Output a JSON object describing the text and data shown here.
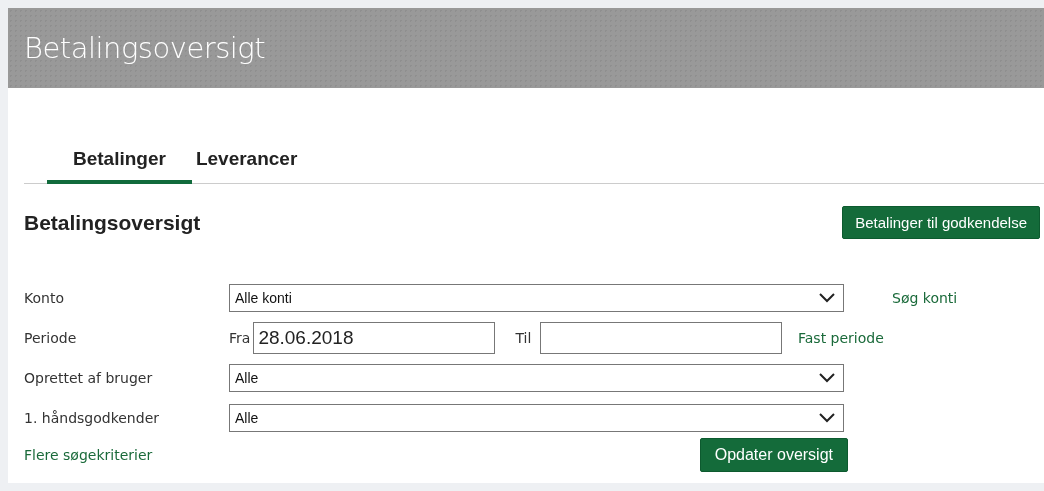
{
  "header": {
    "title": "Betalingsoversigt"
  },
  "tabs": [
    {
      "label": "Betalinger",
      "selected": true
    },
    {
      "label": "Leverancer",
      "selected": false
    }
  ],
  "section": {
    "title": "Betalingsoversigt",
    "action_button": "Betalinger til godkendelse"
  },
  "form": {
    "rows": [
      {
        "kind": "select",
        "label": "Konto",
        "value": "Alle konti",
        "link": "Søg konti"
      },
      {
        "kind": "period",
        "label": "Periode",
        "from_label": "Fra",
        "from_value": "28.06.2018",
        "to_label": "Til",
        "to_value": "",
        "link": "Fast periode"
      },
      {
        "kind": "select",
        "label": "Oprettet af bruger",
        "value": "Alle"
      },
      {
        "kind": "select",
        "label": "1. håndsgodkender",
        "value": "Alle"
      }
    ],
    "more_link": "Flere søgekriterier",
    "submit_button": "Opdater oversigt"
  }
}
